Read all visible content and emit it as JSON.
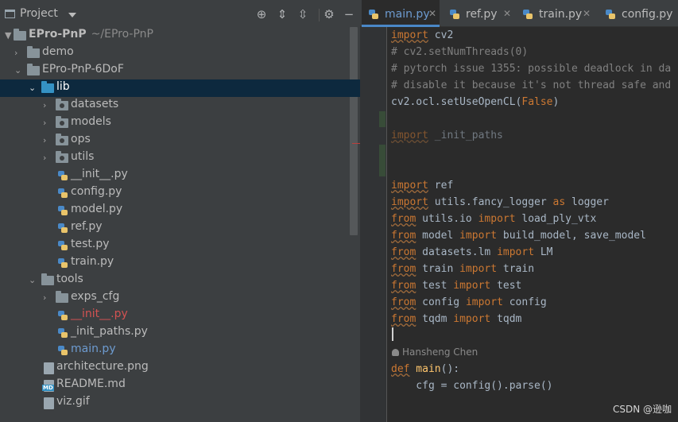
{
  "project_panel": {
    "title": "Project",
    "tree": [
      {
        "label": "EPro-PnP",
        "sub": "~/EPro-PnP"
      },
      {
        "label": "demo"
      },
      {
        "label": "EPro-PnP-6DoF"
      },
      {
        "label": "lib"
      },
      {
        "label": "datasets"
      },
      {
        "label": "models"
      },
      {
        "label": "ops"
      },
      {
        "label": "utils"
      },
      {
        "label": "__init__.py"
      },
      {
        "label": "config.py"
      },
      {
        "label": "model.py"
      },
      {
        "label": "ref.py"
      },
      {
        "label": "test.py"
      },
      {
        "label": "train.py"
      },
      {
        "label": "tools"
      },
      {
        "label": "exps_cfg"
      },
      {
        "label": "__init__.py"
      },
      {
        "label": "_init_paths.py"
      },
      {
        "label": "main.py"
      },
      {
        "label": "architecture.png"
      },
      {
        "label": "README.md"
      },
      {
        "label": "viz.gif"
      }
    ]
  },
  "editor": {
    "tabs": [
      {
        "label": "main.py"
      },
      {
        "label": "ref.py"
      },
      {
        "label": "train.py"
      },
      {
        "label": "config.py"
      }
    ],
    "code": [
      {
        "k": "import",
        "r": " cv2"
      },
      {
        "c": "# cv2.setNumThreads(0)"
      },
      {
        "c": "# pytorch issue 1355: possible deadlock in da"
      },
      {
        "c": "# disable it because it's not thread safe and"
      },
      {
        "r": "cv2.ocl.setUseOpenCL(",
        "k2": "False",
        "r2": ")"
      },
      {
        "k": "import",
        "r": " _init_paths"
      },
      {
        "k": "import",
        "r": " ref"
      },
      {
        "k": "import",
        "r": " utils.fancy_logger ",
        "k2": "as",
        "r2": " logger"
      },
      {
        "k": "from",
        "r": " utils.io ",
        "k2": "import",
        "r2": " load_ply_vtx"
      },
      {
        "k": "from",
        "r": " model ",
        "k2": "import",
        "r2": " build_model, save_model"
      },
      {
        "k": "from",
        "r": " datasets.lm ",
        "k2": "import",
        "r2": " LM"
      },
      {
        "k": "from",
        "r": " train ",
        "k2": "import",
        "r2": " train"
      },
      {
        "k": "from",
        "r": " test ",
        "k2": "import",
        "r2": " test"
      },
      {
        "k": "from",
        "r": " config ",
        "k2": "import",
        "r2": " config"
      },
      {
        "k": "from",
        "r": " tqdm ",
        "k2": "import",
        "r2": " tqdm"
      },
      {
        "k": "def",
        "f": " main",
        "r": "():"
      },
      {
        "r": "    cfg = config().parse()"
      }
    ],
    "author_hint": "Hansheng Chen"
  },
  "watermark": "CSDN @逊咖"
}
